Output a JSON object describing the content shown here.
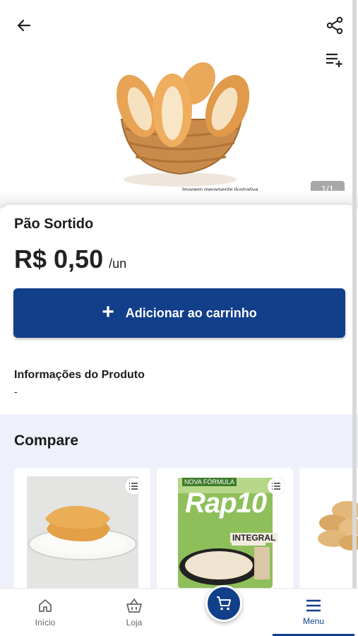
{
  "header": {
    "back_icon": "arrow-left-icon",
    "share_icon": "share-icon",
    "add_to_list_icon": "playlist-add-icon"
  },
  "hero": {
    "image_subject": "bread-rolls-in-basket",
    "disclaimer": "Imagem meramente ilustrativa",
    "pager": "1/1"
  },
  "product": {
    "name": "Pão Sortido",
    "price": "R$ 0,50",
    "unit": "/un",
    "add_to_cart_label": "Adicionar ao carrinho",
    "info_title": "Informações do Produto",
    "info_value": "-"
  },
  "compare": {
    "title": "Compare",
    "cards": [
      {
        "image_subject": "bread-on-plate",
        "list_icon": "list-icon"
      },
      {
        "image_subject": "rap10-integral-package",
        "list_icon": "list-icon"
      },
      {
        "image_subject": "bread-rolls"
      }
    ],
    "rap10_package": {
      "brand": "Rap10",
      "variant": "INTEGRAL",
      "tag": "NOVA FÓRMULA"
    }
  },
  "bottom_nav": {
    "home_label": "Início",
    "store_label": "Loja",
    "menu_label": "Menu",
    "cart_icon": "cart-icon"
  },
  "colors": {
    "primary": "#123f8a",
    "compare_bg": "#eef1fb",
    "pager_bg": "#a8a8a8"
  }
}
